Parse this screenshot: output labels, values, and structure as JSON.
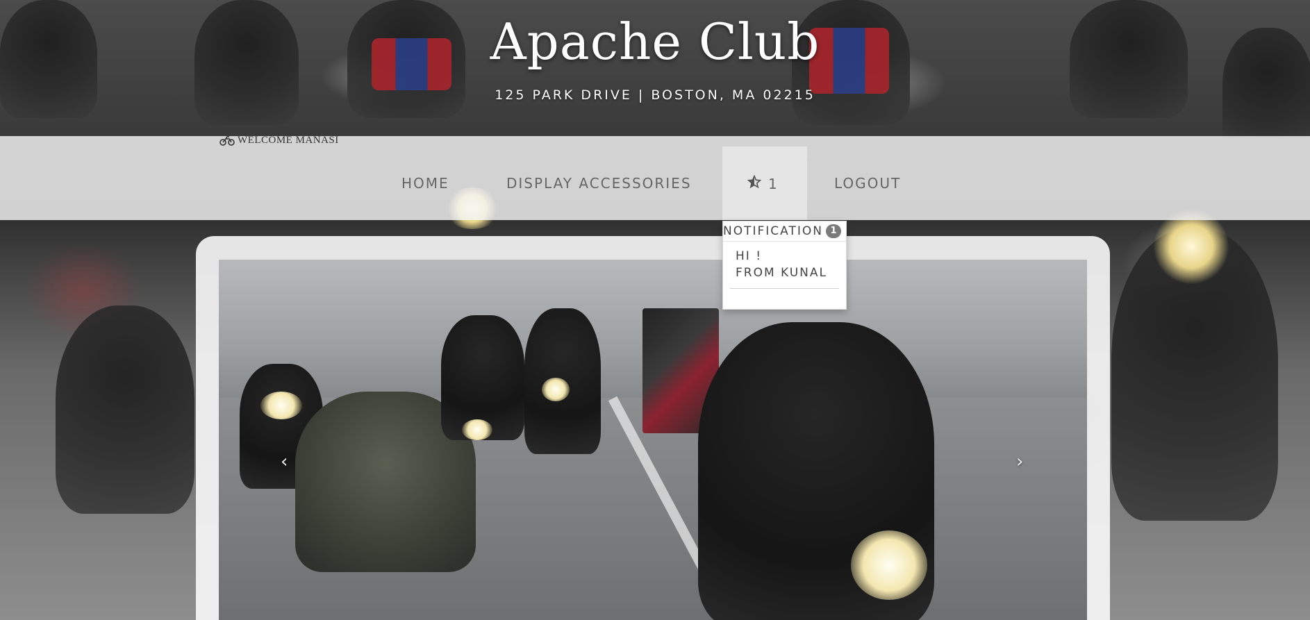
{
  "header": {
    "title": "Apache Club",
    "address": "125 PARK DRIVE | BOSTON, MA 02215"
  },
  "welcome": {
    "icon": "motorcycle-icon",
    "text": "WELCOME MANASI"
  },
  "nav": {
    "home": "HOME",
    "display_accessories": "DISPLAY ACCESSORIES",
    "notifications": {
      "icon": "star-icon",
      "count": "1"
    },
    "logout": "LOGOUT"
  },
  "notification_dropdown": {
    "header": "NOTIFICATION",
    "badge": "1",
    "message_line1": "HI !",
    "message_line2": "FROM KUNAL"
  },
  "carousel": {
    "prev_icon": "‹",
    "next_icon": "›"
  },
  "colors": {
    "nav_text": "#666666",
    "nav_band": "#f5f5f5",
    "badge": "#7a7a7a",
    "title": "#ffffff"
  }
}
